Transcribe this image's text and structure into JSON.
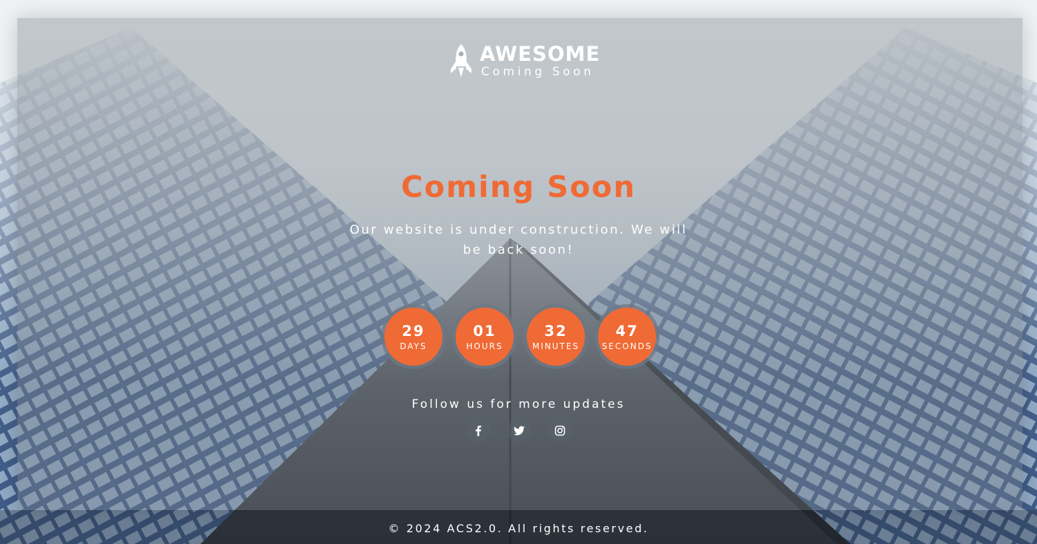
{
  "logo": {
    "title": "AWESOME",
    "subtitle": "Coming Soon",
    "icon": "rocket-icon"
  },
  "hero": {
    "headline": "Coming Soon",
    "message": "Our website is under construction. We will be back soon!"
  },
  "countdown": [
    {
      "value": "29",
      "label": "DAYS"
    },
    {
      "value": "01",
      "label": "HOURS"
    },
    {
      "value": "32",
      "label": "MINUTES"
    },
    {
      "value": "47",
      "label": "SECONDS"
    }
  ],
  "social": {
    "heading": "Follow us for more updates",
    "links": [
      {
        "name": "facebook",
        "icon": "facebook-icon"
      },
      {
        "name": "twitter",
        "icon": "twitter-icon"
      },
      {
        "name": "instagram",
        "icon": "instagram-icon"
      }
    ]
  },
  "footer": {
    "copyright": "© 2024 ACS2.0. All rights reserved."
  },
  "colors": {
    "accent": "#f06a35",
    "text": "#ffffff"
  }
}
